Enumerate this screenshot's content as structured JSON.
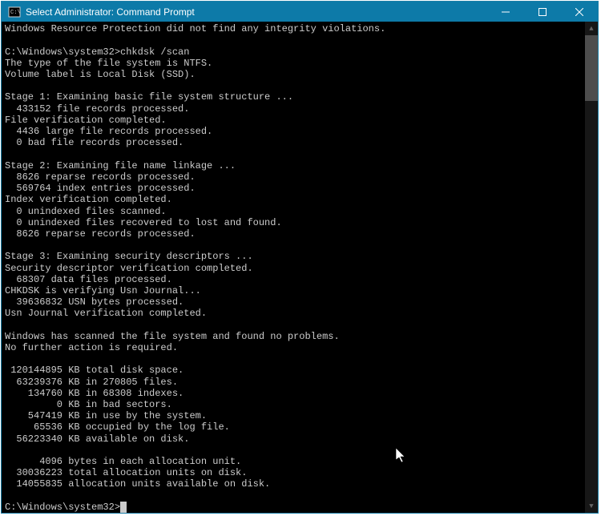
{
  "window": {
    "title": "Select Administrator: Command Prompt"
  },
  "terminal": {
    "lines": [
      "Windows Resource Protection did not find any integrity violations.",
      "",
      "C:\\Windows\\system32>chkdsk /scan",
      "The type of the file system is NTFS.",
      "Volume label is Local Disk (SSD).",
      "",
      "Stage 1: Examining basic file system structure ...",
      "  433152 file records processed.",
      "File verification completed.",
      "  4436 large file records processed.",
      "  0 bad file records processed.",
      "",
      "Stage 2: Examining file name linkage ...",
      "  8626 reparse records processed.",
      "  569764 index entries processed.",
      "Index verification completed.",
      "  0 unindexed files scanned.",
      "  0 unindexed files recovered to lost and found.",
      "  8626 reparse records processed.",
      "",
      "Stage 3: Examining security descriptors ...",
      "Security descriptor verification completed.",
      "  68307 data files processed.",
      "CHKDSK is verifying Usn Journal...",
      "  39636832 USN bytes processed.",
      "Usn Journal verification completed.",
      "",
      "Windows has scanned the file system and found no problems.",
      "No further action is required.",
      "",
      " 120144895 KB total disk space.",
      "  63239376 KB in 270805 files.",
      "    134760 KB in 68308 indexes.",
      "         0 KB in bad sectors.",
      "    547419 KB in use by the system.",
      "     65536 KB occupied by the log file.",
      "  56223340 KB available on disk.",
      "",
      "      4096 bytes in each allocation unit.",
      "  30036223 total allocation units on disk.",
      "  14055835 allocation units available on disk.",
      ""
    ],
    "prompt": "C:\\Windows\\system32>"
  }
}
